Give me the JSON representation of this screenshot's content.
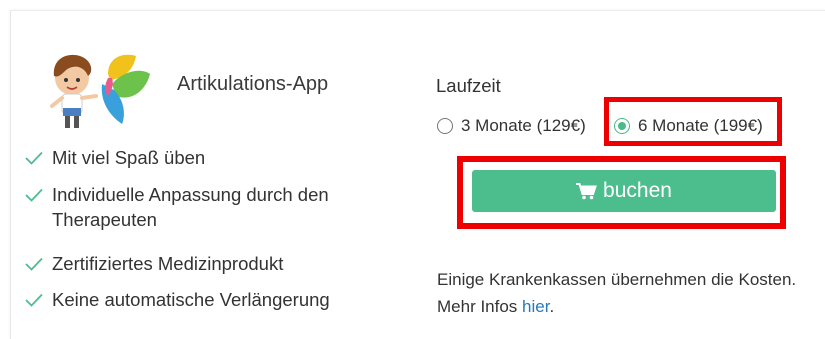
{
  "product": {
    "name": "Artikulations-App"
  },
  "features": [
    "Mit viel Spaß üben",
    "Individuelle Anpassung durch den Therapeuten",
    "Zertifiziertes Medizinprodukt",
    "Keine automatische Verlängerung"
  ],
  "duration": {
    "label": "Laufzeit",
    "options": [
      {
        "label": "3 Monate (129€)",
        "selected": false
      },
      {
        "label": "6 Monate (199€)",
        "selected": true
      }
    ]
  },
  "buy_button": {
    "label": "buchen",
    "icon": "shopping-cart-icon"
  },
  "note": {
    "text": "Einige Krankenkassen übernehmen die Kosten. Mehr Infos ",
    "link": "hier",
    "end": "."
  },
  "colors": {
    "accent": "#4cbe8e",
    "highlight": "#ee0000",
    "link": "#2a7ab8"
  }
}
